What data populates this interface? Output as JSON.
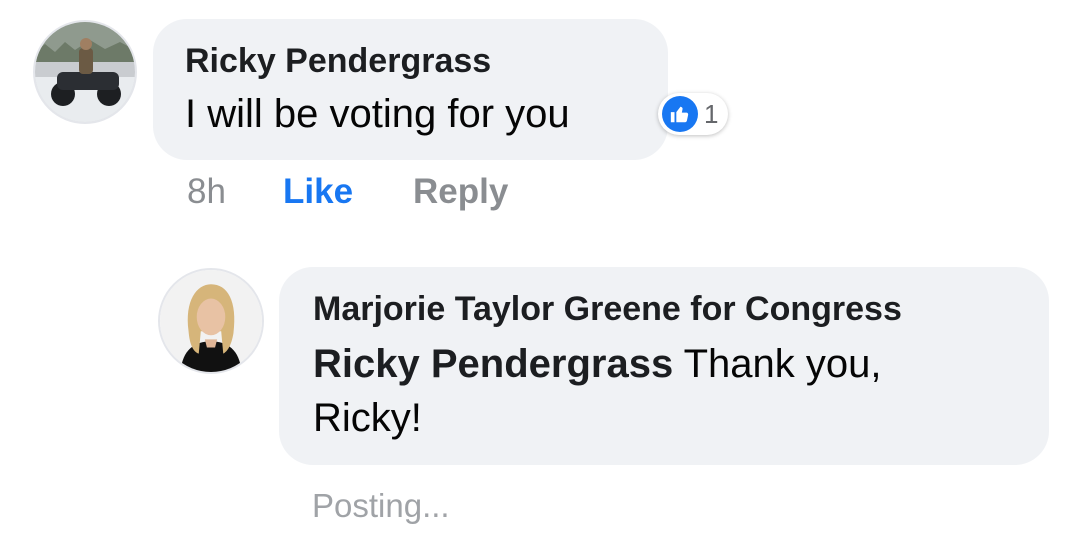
{
  "comment": {
    "author": "Ricky Pendergrass",
    "text": "I will be voting for you",
    "reaction_count": "1",
    "time": "8h",
    "like_label": "Like",
    "reply_label": "Reply",
    "reaction_icon": "thumbs-up-icon"
  },
  "reply": {
    "author": "Marjorie Taylor Greene for Congress",
    "mention": "Ricky Pendergrass",
    "text_line1": " Thank you,",
    "text_line2": "Ricky!",
    "status": "Posting..."
  },
  "colors": {
    "accent": "#1877f2",
    "bubble": "#f0f2f5",
    "muted": "#8a8d91"
  }
}
